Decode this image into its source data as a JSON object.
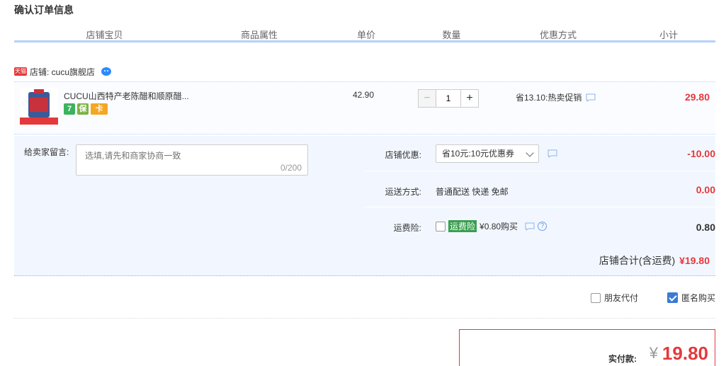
{
  "page": {
    "title": "确认订单信息"
  },
  "columns": [
    "店铺宝贝",
    "商品属性",
    "单价",
    "数量",
    "优惠方式",
    "小计"
  ],
  "shop": {
    "tmall_badge": "天猫",
    "label": "店铺: cucu旗舰店"
  },
  "item": {
    "title": "CUCU山西特产老陈醋和顺原醋...",
    "unit_price": "42.90",
    "quantity": "1",
    "qty_minus": "−",
    "qty_plus": "+",
    "promo": "省13.10:热卖促销",
    "subtotal": "29.80",
    "badges": [
      "7",
      "保",
      "卡"
    ]
  },
  "message": {
    "label": "给卖家留言:",
    "placeholder": "选填,请先和商家协商一致",
    "count": "0/200"
  },
  "shop_discount": {
    "label": "店铺优惠:",
    "selected": "省10元:10元优惠券",
    "value": "-10.00"
  },
  "shipping": {
    "label": "运送方式:",
    "text": "普通配送 快递 免邮",
    "value": "0.00"
  },
  "insurance": {
    "label": "运费险:",
    "tag": "运费险",
    "text": "¥0.80购买",
    "help": "?",
    "value": "0.80"
  },
  "shop_total": {
    "label": "店铺合计(含运费)",
    "amount": "¥19.80"
  },
  "pay_options": {
    "friend_pay": "朋友代付",
    "anonymous": "匿名购买"
  },
  "payment": {
    "label": "实付款:",
    "yen": "¥",
    "amount": "19.80"
  },
  "colors": {
    "accent_red": "#e4393c",
    "blue_line": "#b2d1ff",
    "panel_bg": "#f2f7ff"
  }
}
